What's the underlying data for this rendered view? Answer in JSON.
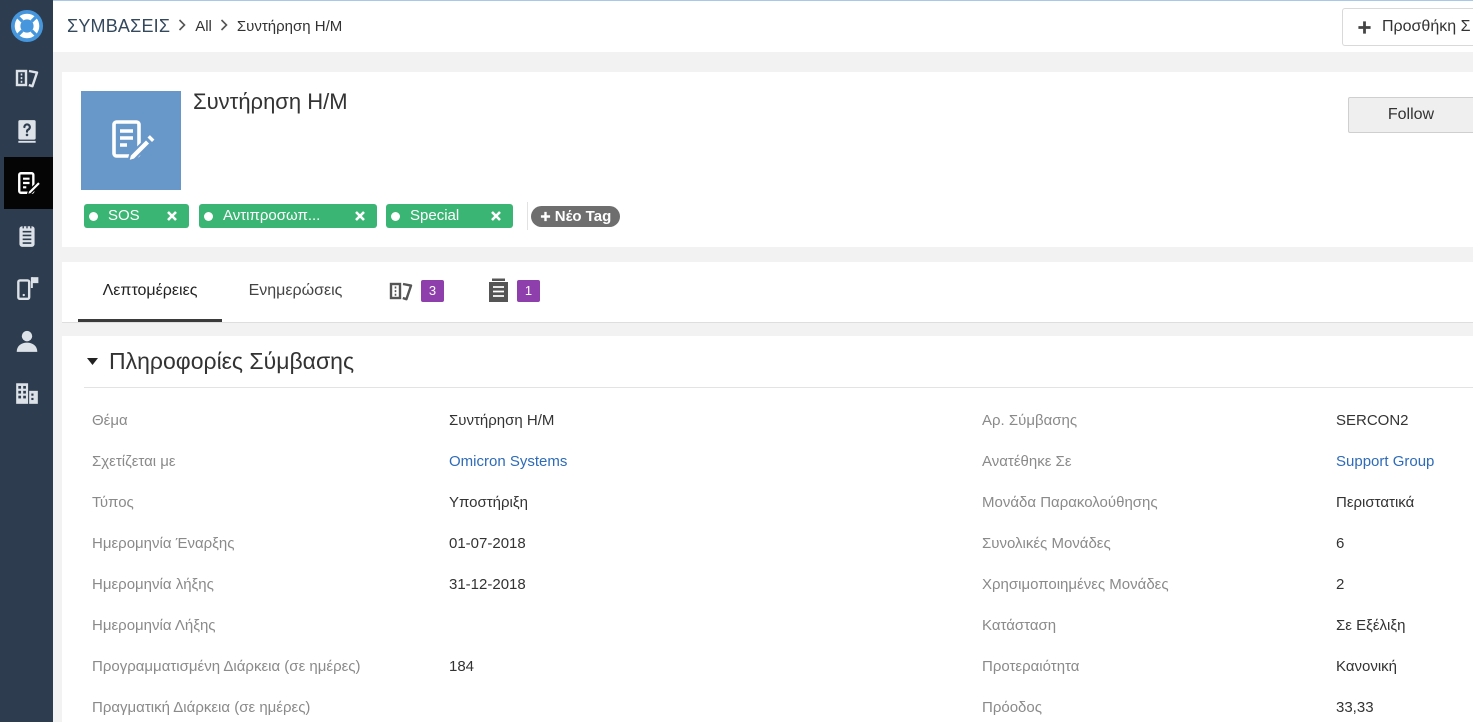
{
  "theme": {
    "sidebar_bg": "#2d3d4f",
    "sidebar_active_bg": "#050505",
    "logo_blue": "#4596dc",
    "avatar_blue": "#6897c9",
    "tag_green": "#3bb573",
    "new_tag_gray": "#6e6e6e",
    "badge_purple": "#8e3fab",
    "link_blue": "#2e6bb8"
  },
  "sidebar": {
    "logo_icon": "lifebuoy-icon",
    "items": [
      {
        "icon": "tickets-icon",
        "active": false
      },
      {
        "icon": "knowledge-base-icon",
        "active": false
      },
      {
        "icon": "contract-edit-icon",
        "active": true
      },
      {
        "icon": "notes-icon",
        "active": false
      },
      {
        "icon": "mobile-flag-icon",
        "active": false
      },
      {
        "icon": "person-icon",
        "active": false
      },
      {
        "icon": "buildings-icon",
        "active": false
      }
    ]
  },
  "header": {
    "breadcrumb": {
      "module": "ΣΥΜΒΑΣΕΙΣ",
      "filter": "All",
      "current": "Συντήρηση Η/Μ",
      "separator_icon": "chevron-right-icon"
    },
    "add_button": {
      "icon": "plus-icon",
      "label": "Προσθήκη Σ"
    }
  },
  "record": {
    "avatar_icon": "contract-edit-icon",
    "title": "Συντήρηση Η/Μ",
    "follow_label": "Follow",
    "tags": [
      {
        "label": "SOS",
        "dot_icon": "dot-icon",
        "remove_icon": "close-icon"
      },
      {
        "label": "Αντιπροσωπ...",
        "dot_icon": "dot-icon",
        "remove_icon": "close-icon"
      },
      {
        "label": "Special",
        "dot_icon": "dot-icon",
        "remove_icon": "close-icon"
      }
    ],
    "new_tag": {
      "icon": "plus-icon",
      "label": "Νέο Tag"
    }
  },
  "tabs": [
    {
      "label": "Λεπτομέρειες",
      "active": true
    },
    {
      "label": "Ενημερώσεις",
      "active": false
    },
    {
      "icon": "tickets-icon",
      "badge": "3",
      "active": false
    },
    {
      "icon": "document-icon",
      "badge": "1",
      "active": false
    }
  ],
  "section": {
    "title": "Πληροφορίες Σύμβασης",
    "toggle_icon": "caret-down-icon",
    "rows": [
      {
        "left": {
          "label": "Θέμα",
          "value": "Συντήρηση Η/Μ"
        },
        "right": {
          "label": "Αρ. Σύμβασης",
          "value": "SERCON2"
        }
      },
      {
        "left": {
          "label": "Σχετίζεται με",
          "value": "Omicron Systems",
          "link": true
        },
        "right": {
          "label": "Ανατέθηκε Σε",
          "value": "Support Group",
          "link": true
        }
      },
      {
        "left": {
          "label": "Τύπος",
          "value": "Υποστήριξη"
        },
        "right": {
          "label": "Μονάδα Παρακολούθησης",
          "value": "Περιστατικά"
        }
      },
      {
        "left": {
          "label": "Ημερομηνία Έναρξης",
          "value": "01-07-2018"
        },
        "right": {
          "label": "Συνολικές Μονάδες",
          "value": "6"
        }
      },
      {
        "left": {
          "label": "Ημερομηνία λήξης",
          "value": "31-12-2018"
        },
        "right": {
          "label": "Χρησιμοποιημένες Μονάδες",
          "value": "2"
        }
      },
      {
        "left": {
          "label": "Ημερομηνία Λήξης",
          "value": ""
        },
        "right": {
          "label": "Κατάσταση",
          "value": "Σε Εξέλιξη"
        }
      },
      {
        "left": {
          "label": "Προγραμματισμένη Διάρκεια (σε ημέρες)",
          "value": "184"
        },
        "right": {
          "label": "Προτεραιότητα",
          "value": "Κανονική"
        }
      },
      {
        "left": {
          "label": "Πραγματική Διάρκεια (σε ημέρες)",
          "value": ""
        },
        "right": {
          "label": "Πρόοδος",
          "value": "33,33"
        }
      }
    ]
  }
}
